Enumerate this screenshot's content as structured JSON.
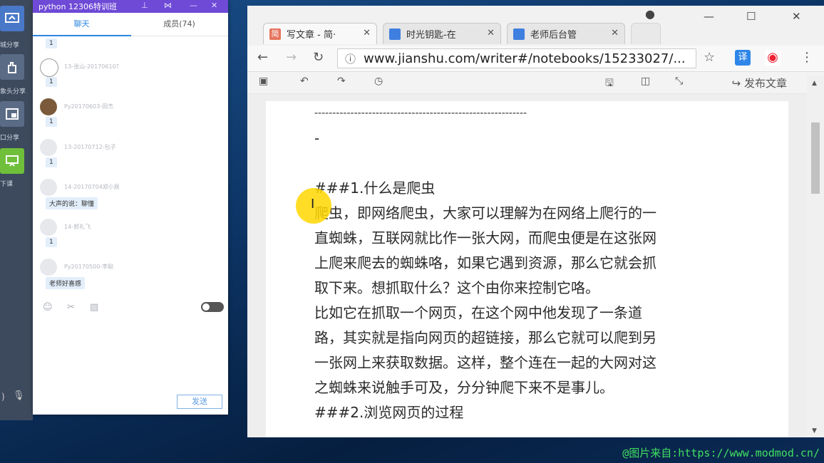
{
  "dock": {
    "items": [
      {
        "label": "屏幕分享",
        "visible": "城分享"
      },
      {
        "label": "摄像头分享",
        "visible": "象头分享"
      },
      {
        "label": "窗口分享",
        "visible": "口分享"
      },
      {
        "label": "下课",
        "visible": "下课"
      }
    ]
  },
  "chat": {
    "title": "python 12306特训班",
    "tabs": [
      "聊天",
      "成员(74)"
    ],
    "messages": [
      {
        "name": "",
        "text": "1"
      },
      {
        "name": "13-张山-20170610?",
        "text": "1"
      },
      {
        "name": "Py20170603-田杰",
        "text": "1"
      },
      {
        "name": "13-20170712-包子",
        "text": "1"
      },
      {
        "name": "14-20170704郑小辰",
        "text": "大声的说：聊懂"
      },
      {
        "name": "14-郭礼飞",
        "text": "1"
      },
      {
        "name": "Py20170500-李聪",
        "text": "老师好喜感"
      }
    ],
    "send_label": "发送"
  },
  "browser": {
    "tabs": [
      {
        "title": "写文章 - 简·",
        "fav_color": "#e6735c",
        "fav_text": "简"
      },
      {
        "title": "时光钥匙-在",
        "fav_color": "#3f7fe0",
        "fav_text": ""
      },
      {
        "title": "老师后台管",
        "fav_color": "#3f7fe0",
        "fav_text": ""
      }
    ],
    "url": "www.jianshu.com/writer#/notebooks/15233027/...",
    "publish_label": "发布文章"
  },
  "document": {
    "lines": [
      "-----------------------------------------------------------",
      "-",
      "",
      "###1.什么是爬虫",
      "爬虫，即网络爬虫，大家可以理解为在网络上爬行的一",
      "直蜘蛛，互联网就比作一张大网，而爬虫便是在这张网",
      "上爬来爬去的蜘蛛咯，如果它遇到资源，那么它就会抓",
      "取下来。想抓取什么？这个由你来控制它咯。",
      "比如它在抓取一个网页，在这个网中他发现了一条道",
      "路，其实就是指向网页的超链接，那么它就可以爬到另",
      "一张网上来获取数据。这样，整个连在一起的大网对这",
      "之蜘蛛来说触手可及，分分钟爬下来不是事儿。",
      "###2.浏览网页的过程"
    ]
  },
  "watermark": "@图片来自:https://www.modmod.cn/"
}
